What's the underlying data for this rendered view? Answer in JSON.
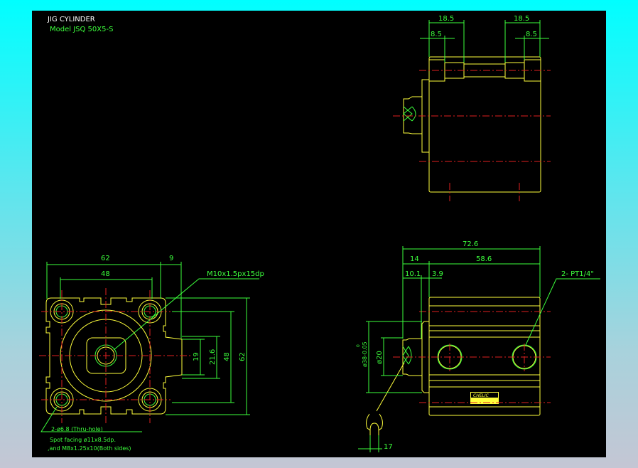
{
  "title": "JIG CYLINDER",
  "model": "Model  JSQ  50X5-S",
  "colors": {
    "background_top": "#00ffff",
    "canvas": "#000000",
    "outline": "#ffff3c",
    "dimension": "#3cff3c",
    "centerline": "#e02020"
  },
  "front_view": {
    "dims": {
      "width_62": "62",
      "offset_9": "9",
      "pitch_48": "48",
      "port_19": "19",
      "port_21_6": "21.6",
      "height_48": "48",
      "height_62": "62"
    },
    "thread_note": "M10x1.5px15dp",
    "hole_note": "2-ø6.8 (Thru-hole)",
    "spot_note": "Spot facing  ø11x8.5dp.",
    "and_note": ",and  M8x1.25x10(Both sides)"
  },
  "top_view": {
    "dims": {
      "left_18_5": "18.5",
      "right_18_5": "18.5",
      "left_8_5": "8.5",
      "right_8_5": "8.5"
    }
  },
  "side_view": {
    "dims": {
      "total": "72.6",
      "rod": "14",
      "body": "58.6",
      "rod_end": "10.1",
      "cap": "3.9",
      "dia38": "ø38-0.05",
      "dia38_tol": "0",
      "dia20": "ø20",
      "hook": "17"
    },
    "port_note": "2-  PT1/4\"",
    "plate_label": "CHELIC"
  }
}
